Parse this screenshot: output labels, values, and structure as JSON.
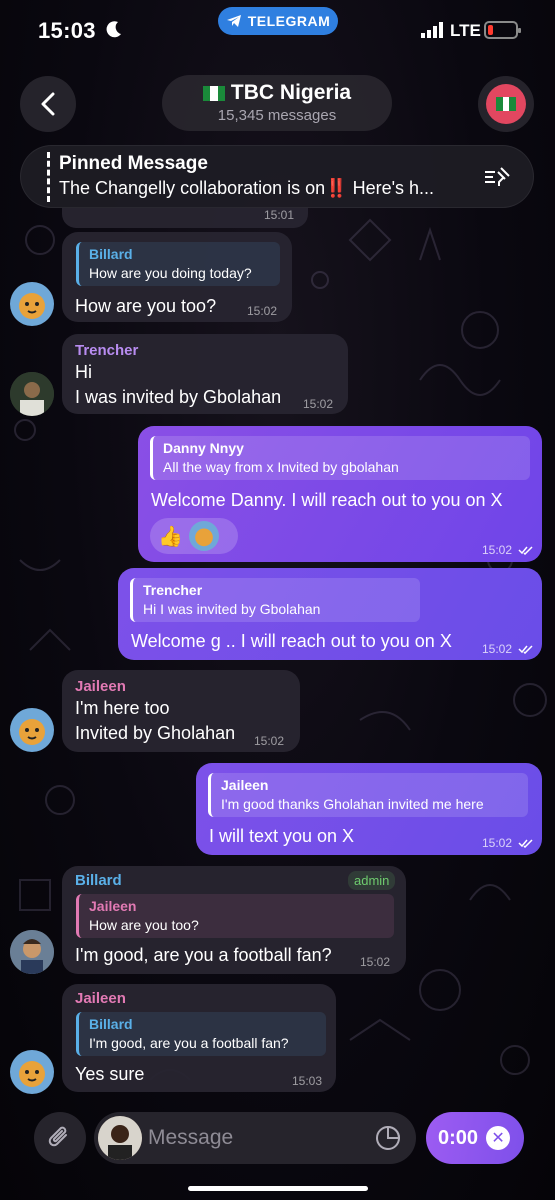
{
  "status": {
    "time": "15:03",
    "pill": "TELEGRAM",
    "network": "LTE"
  },
  "header": {
    "title": "TBC Nigeria",
    "subtitle": "15,345 messages"
  },
  "pinned": {
    "title": "Pinned Message",
    "text": "The Changelly collaboration is on‼️ Here's h..."
  },
  "top_time": "15:01",
  "messages": [
    {
      "reply_name": "Billard",
      "reply_text": "How are you doing today?",
      "text": "How are you too?",
      "time": "15:02"
    },
    {
      "sender": "Trencher",
      "line1": "Hi",
      "line2": "I was invited by Gbolahan",
      "time": "15:02"
    },
    {
      "reply_name": "Danny Nnyy",
      "reply_text": "All the way from x Invited by gbolahan",
      "text": "Welcome Danny. I will reach out to you on X",
      "reaction": "👍",
      "time": "15:02"
    },
    {
      "reply_name": "Trencher",
      "reply_text": "Hi I was invited by Gbolahan",
      "text": "Welcome g .. I will reach out to you on X",
      "time": "15:02"
    },
    {
      "sender": "Jaileen",
      "line1": "I'm here too",
      "line2": "Invited by Gholahan",
      "time": "15:02"
    },
    {
      "reply_name": "Jaileen",
      "reply_text": "I'm good thanks Gholahan invited me here",
      "text": "I will text you on X",
      "time": "15:02"
    },
    {
      "sender": "Billard",
      "badge": "admin",
      "reply_name": "Jaileen",
      "reply_text": "How are you too?",
      "text": "I'm good, are you a football fan?",
      "time": "15:02"
    },
    {
      "sender": "Jaileen",
      "reply_name": "Billard",
      "reply_text": "I'm good, are you a football fan?",
      "text": "Yes sure",
      "time": "15:03"
    }
  ],
  "composer": {
    "placeholder": "Message",
    "record_time": "0:00"
  },
  "colors": {
    "accent": "#2f7fe0",
    "outgoing": "#7b4ce8",
    "billard": "#5ab0e8",
    "trencher": "#b88cf0",
    "jaileen": "#e27ab4"
  }
}
